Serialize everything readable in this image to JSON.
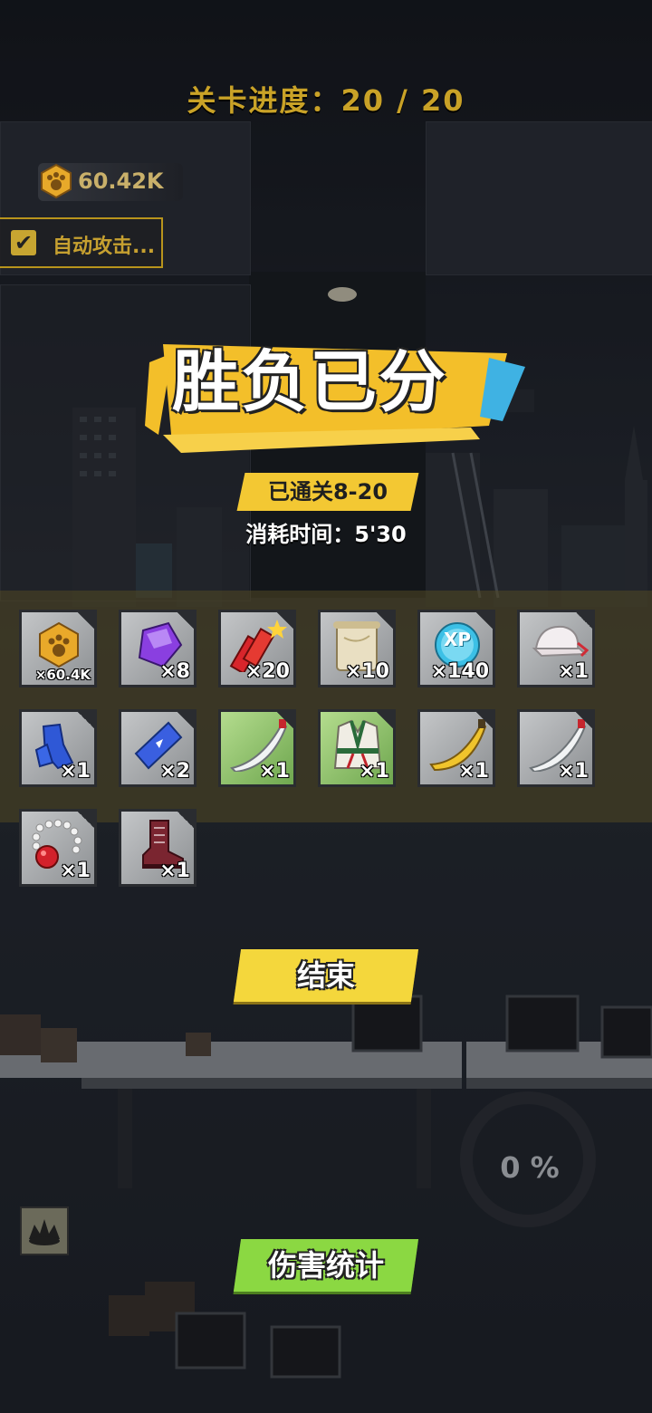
{
  "header": {
    "stage_progress": "关卡进度：20 / 20"
  },
  "hud": {
    "coins": "60.42K",
    "auto_attack_label": "自动攻击..."
  },
  "result": {
    "title": "胜负已分",
    "stage_cleared": "已通关8-20",
    "time_used": "消耗时间：5'30"
  },
  "rewards": [
    {
      "name": "paw-coin",
      "count": "×60.4K"
    },
    {
      "name": "purple-gem",
      "count": "×8"
    },
    {
      "name": "firecracker",
      "count": "×20"
    },
    {
      "name": "scroll",
      "count": "×10"
    },
    {
      "name": "xp-orb",
      "count": "×140",
      "badge": "XP"
    },
    {
      "name": "white-cap",
      "count": "×1"
    },
    {
      "name": "blue-gloves",
      "count": "×1"
    },
    {
      "name": "blue-ticket",
      "count": "×2"
    },
    {
      "name": "silver-blade",
      "count": "×1"
    },
    {
      "name": "martial-arts-robe",
      "count": "×1"
    },
    {
      "name": "golden-blade",
      "count": "×1"
    },
    {
      "name": "silver-blade-2",
      "count": "×1"
    },
    {
      "name": "bead-necklace",
      "count": "×1"
    },
    {
      "name": "red-boot",
      "count": "×1"
    }
  ],
  "buttons": {
    "end_label": "结束",
    "damage_stats_label": "伤害统计"
  },
  "charge": {
    "percent": "0 %"
  },
  "colors": {
    "accent_yellow": "#f4d73c",
    "accent_green": "#8bd842",
    "gold_text": "#c9a227"
  }
}
